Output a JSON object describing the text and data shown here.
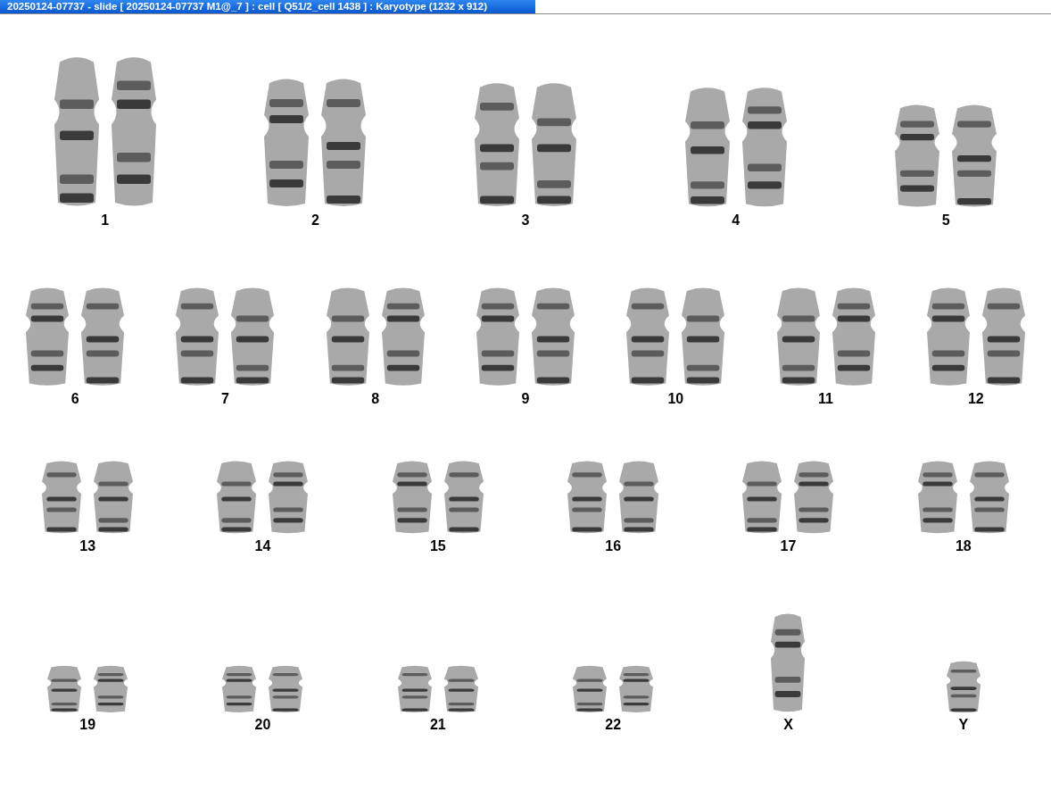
{
  "window": {
    "title": "20250124-07737 - slide [ 20250124-07737 M1@_7 ] : cell [ Q51/2_cell 1438 ] : Karyotype  (1232 x 912)"
  },
  "rows": [
    {
      "items": [
        {
          "label": "1",
          "kind": "pair"
        },
        {
          "label": "2",
          "kind": "pair"
        },
        {
          "label": "3",
          "kind": "pair"
        },
        {
          "label": "4",
          "kind": "pair"
        },
        {
          "label": "5",
          "kind": "pair"
        }
      ]
    },
    {
      "items": [
        {
          "label": "6",
          "kind": "pair"
        },
        {
          "label": "7",
          "kind": "pair"
        },
        {
          "label": "8",
          "kind": "pair"
        },
        {
          "label": "9",
          "kind": "pair"
        },
        {
          "label": "10",
          "kind": "pair"
        },
        {
          "label": "11",
          "kind": "pair"
        },
        {
          "label": "12",
          "kind": "pair"
        }
      ]
    },
    {
      "items": [
        {
          "label": "13",
          "kind": "pair"
        },
        {
          "label": "14",
          "kind": "pair"
        },
        {
          "label": "15",
          "kind": "pair"
        },
        {
          "label": "16",
          "kind": "pair"
        },
        {
          "label": "17",
          "kind": "pair"
        },
        {
          "label": "18",
          "kind": "pair"
        }
      ]
    },
    {
      "items": [
        {
          "label": "19",
          "kind": "pair"
        },
        {
          "label": "20",
          "kind": "pair"
        },
        {
          "label": "21",
          "kind": "pair"
        },
        {
          "label": "22",
          "kind": "pair"
        },
        {
          "label": "X",
          "kind": "single"
        },
        {
          "label": "Y",
          "kind": "single"
        }
      ]
    }
  ]
}
